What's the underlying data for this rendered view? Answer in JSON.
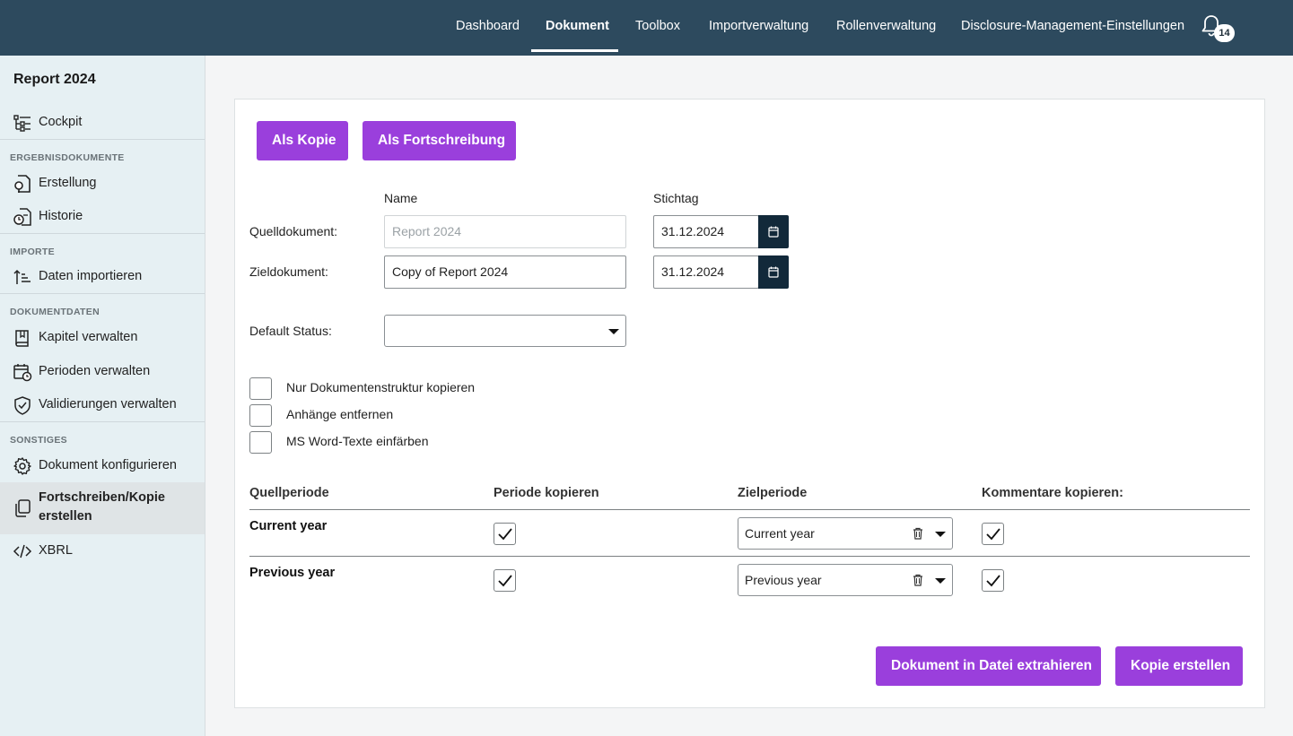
{
  "topnav": {
    "items": [
      "Dashboard",
      "Dokument",
      "Toolbox",
      "Importverwaltung",
      "Rollenverwaltung",
      "Disclosure-Management-Einstellungen"
    ],
    "active": "Dokument",
    "notification_count": "14"
  },
  "sidebar": {
    "title": "Report 2024",
    "cockpit": "Cockpit",
    "sections": {
      "ergebnis": "ERGEBNISDOKUMENTE",
      "importe": "IMPORTE",
      "dokumentdaten": "DOKUMENTDATEN",
      "sonstiges": "SONSTIGES"
    },
    "items": {
      "erstellung": "Erstellung",
      "historie": "Historie",
      "daten_importieren": "Daten importieren",
      "kapitel": "Kapitel verwalten",
      "perioden": "Perioden verwalten",
      "validierungen": "Validierungen verwalten",
      "konfigurieren": "Dokument konfigurieren",
      "fortschreiben": "Fortschreiben/Kopie erstellen",
      "xbrl": "XBRL"
    },
    "active_item": "Fortschreiben/Kopie erstellen"
  },
  "mode_buttons": {
    "als_kopie": "Als Kopie",
    "als_fortschreibung": "Als Fortschreibung"
  },
  "form": {
    "col_name": "Name",
    "col_stichtag": "Stichtag",
    "quell_label": "Quelldokument:",
    "quell_name": "Report 2024",
    "quell_date": "31.12.2024",
    "ziel_label": "Zieldokument:",
    "ziel_name": "Copy of Report 2024",
    "ziel_date": "31.12.2024",
    "status_label": "Default Status:",
    "status_value": ""
  },
  "options": [
    {
      "label": "Nur Dokumentenstruktur kopieren",
      "checked": false
    },
    {
      "label": "Anhänge entfernen",
      "checked": false
    },
    {
      "label": "MS Word-Texte einfärben",
      "checked": false
    }
  ],
  "period_table": {
    "headers": [
      "Quellperiode",
      "Periode kopieren",
      "Zielperiode",
      "Kommentare kopieren:"
    ],
    "rows": [
      {
        "source": "Current year",
        "copy_period": true,
        "target": "Current year",
        "copy_comments": true
      },
      {
        "source": "Previous year",
        "copy_period": true,
        "target": "Previous year",
        "copy_comments": true
      }
    ]
  },
  "actions": {
    "extract": "Dokument in Datei extrahieren",
    "create_copy": "Kopie erstellen"
  },
  "colors": {
    "topbar": "#2d4a5e",
    "accent_purple": "#9a3fdc",
    "calendar_button": "#12293a",
    "sidebar_bg": "#e6f0f3"
  }
}
